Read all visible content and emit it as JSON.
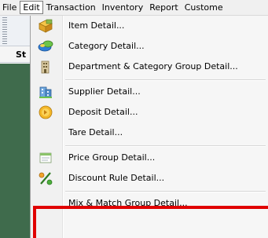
{
  "menubar": {
    "items": [
      {
        "label": "File"
      },
      {
        "label": "Edit",
        "active": true
      },
      {
        "label": "Transaction"
      },
      {
        "label": "Inventory"
      },
      {
        "label": "Report"
      },
      {
        "label": "Custome"
      }
    ]
  },
  "background": {
    "tab_label": "St"
  },
  "edit_menu": {
    "items": [
      {
        "label": "Item Detail...",
        "icon": "box-icon"
      },
      {
        "label": "Category Detail...",
        "icon": "category-icon"
      },
      {
        "label": "Department & Category Group Detail...",
        "icon": "building-icon"
      },
      {
        "label": "Supplier Detail...",
        "icon": "supplier-icon"
      },
      {
        "label": "Deposit Detail...",
        "icon": "deposit-icon"
      },
      {
        "label": "Tare Detail...",
        "icon": ""
      },
      {
        "label": "Price Group Detail...",
        "icon": "price-group-icon"
      },
      {
        "label": "Discount Rule Detail...",
        "icon": "discount-icon"
      },
      {
        "label": "Mix & Match Group Detail...",
        "icon": ""
      }
    ]
  },
  "colors": {
    "highlight": "#e00000",
    "background_app": "#3f6b4c"
  }
}
